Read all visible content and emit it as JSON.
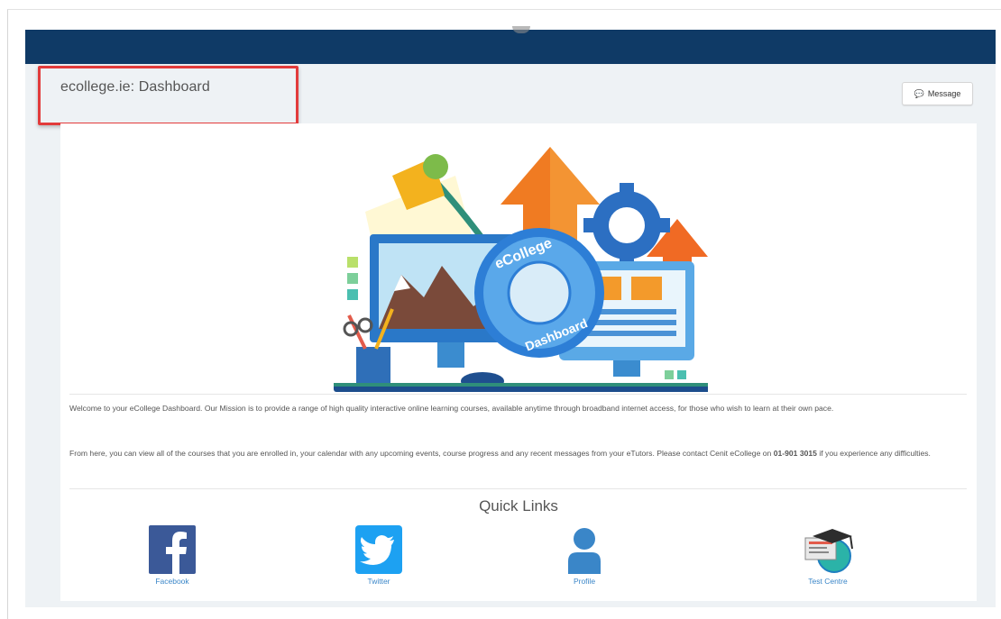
{
  "header": {
    "page_title": "ecollege.ie: Dashboard",
    "message_label": "Message"
  },
  "hero": {
    "badge_line1": "eCollege",
    "badge_line2": "Dashboard"
  },
  "welcome": {
    "paragraph1": "Welcome to your eCollege Dashboard. Our Mission is to provide a range of high quality interactive online learning courses, available anytime through broadband internet access, for those who wish to learn at their own pace.",
    "paragraph2_start": "From here, you can view all of the courses that you are enrolled in, your calendar with any upcoming events, course progress and any recent messages from your eTutors. Please contact Cenit eCollege on ",
    "phone": "01-901 3015",
    "paragraph2_end": " if you experience any difficulties."
  },
  "quick_links": {
    "title": "Quick Links",
    "items": [
      {
        "label": "Facebook",
        "icon": "facebook-icon"
      },
      {
        "label": "Twitter",
        "icon": "twitter-icon"
      },
      {
        "label": "Profile",
        "icon": "profile-icon"
      },
      {
        "label": "Test Centre",
        "icon": "test-centre-icon"
      }
    ]
  },
  "colors": {
    "topbar": "#0f3a66",
    "highlight_border": "#e23b3b",
    "link": "#3a86c8",
    "facebook": "#3b5998",
    "twitter": "#1da1f2",
    "profile": "#3a86c8"
  }
}
